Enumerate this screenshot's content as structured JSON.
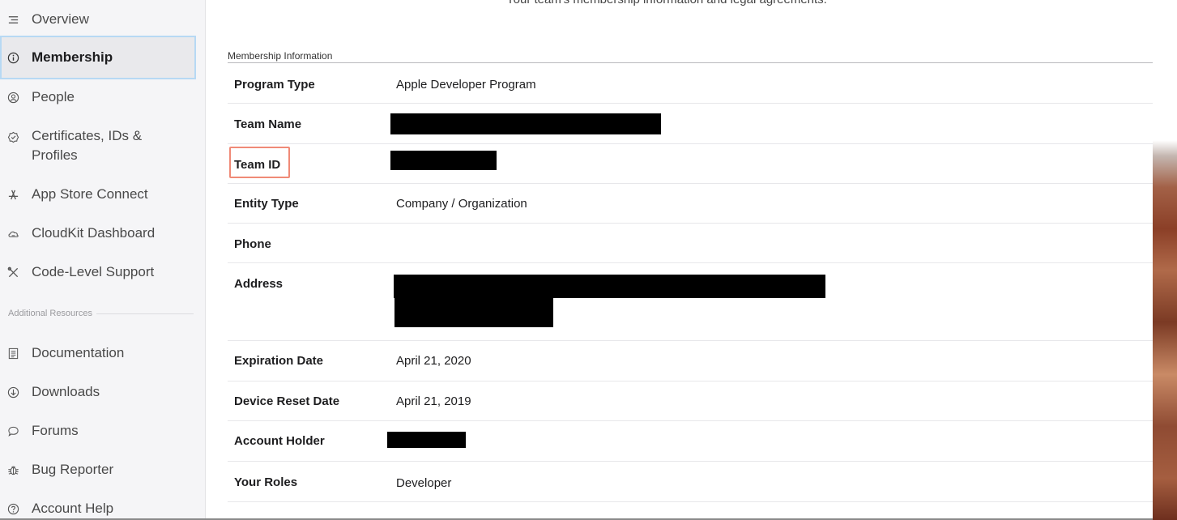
{
  "sidebar": {
    "items": [
      {
        "label": "Overview",
        "icon": "list-icon"
      },
      {
        "label": "Membership",
        "icon": "info-icon",
        "active": true
      },
      {
        "label": "People",
        "icon": "person-icon"
      },
      {
        "label": "Certificates, IDs & Profiles",
        "icon": "certificate-icon"
      },
      {
        "label": "App Store Connect",
        "icon": "app-store-icon"
      },
      {
        "label": "CloudKit Dashboard",
        "icon": "cloud-icon"
      },
      {
        "label": "Code-Level Support",
        "icon": "tools-icon"
      }
    ],
    "section_label": "Additional Resources",
    "resources": [
      {
        "label": "Documentation",
        "icon": "document-icon"
      },
      {
        "label": "Downloads",
        "icon": "download-icon"
      },
      {
        "label": "Forums",
        "icon": "chat-bubble-icon"
      },
      {
        "label": "Bug Reporter",
        "icon": "bug-icon"
      },
      {
        "label": "Account Help",
        "icon": "question-icon"
      }
    ]
  },
  "main": {
    "intro": "Your team's membership information and legal agreements.",
    "section_title": "Membership Information",
    "rows": [
      {
        "label": "Program Type",
        "value": "Apple Developer Program"
      },
      {
        "label": "Team Name",
        "value": ""
      },
      {
        "label": "Team ID",
        "value": ""
      },
      {
        "label": "Entity Type",
        "value": "Company / Organization"
      },
      {
        "label": "Phone",
        "value": ""
      },
      {
        "label": "Address",
        "value": ""
      },
      {
        "label": "Expiration Date",
        "value": "April 21, 2020"
      },
      {
        "label": "Device Reset Date",
        "value": "April 21, 2019"
      },
      {
        "label": "Account Holder",
        "value": ""
      },
      {
        "label": "Your Roles",
        "value": "Developer"
      }
    ]
  },
  "colors": {
    "highlight": "#f08a77",
    "active_border": "#b7d9f4",
    "sidebar_bg": "#f5f5f7"
  }
}
